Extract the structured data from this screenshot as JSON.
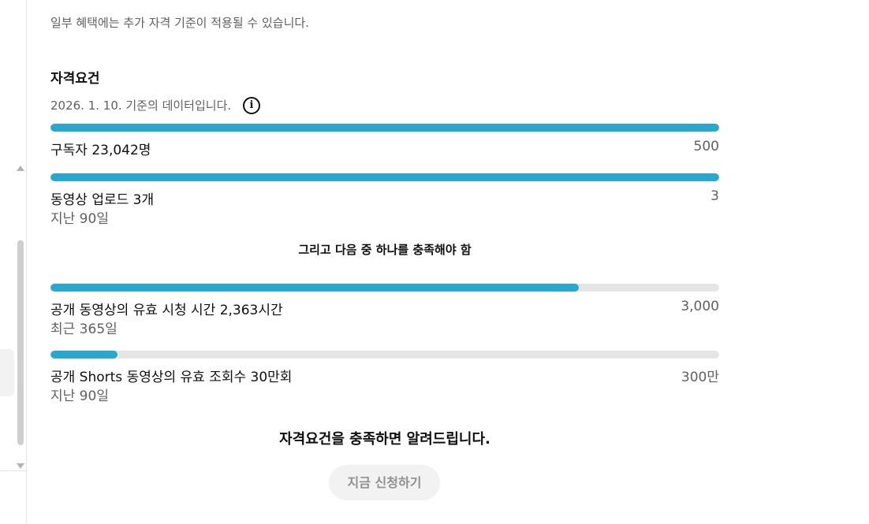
{
  "notice": "일부 혜택에는 추가 자격 기준이 적용될 수 있습니다.",
  "eligibility": {
    "title": "자격요건",
    "data_date": "2026. 1. 10. 기준의 데이터입니다.",
    "info_icon": "info-circle-icon",
    "requirements": [
      {
        "label": "구독자 23,042명",
        "target": "500",
        "period": "",
        "progress": 1.0
      },
      {
        "label": "동영상 업로드 3개",
        "target": "3",
        "period": "지난 90일",
        "progress": 1.0
      }
    ],
    "and_text": "그리고 다음 중 하나를 충족해야 함",
    "alternatives": [
      {
        "label": "공개 동영상의 유효 시청 시간 2,363시간",
        "target": "3,000",
        "period": "최근 365일",
        "progress": 0.79
      },
      {
        "label": "공개 Shorts 동영상의 유효 조회수 30만회",
        "target": "300만",
        "period": "지난 90일",
        "progress": 0.1
      }
    ],
    "notify_text": "자격요건을 충족하면 알려드립니다.",
    "apply_button": "지금 신청하기"
  },
  "colors": {
    "progress_fill": "#2aa7cd",
    "progress_track": "#e5e5e5",
    "button_bg": "#f2f2f2",
    "button_text": "#909090"
  }
}
